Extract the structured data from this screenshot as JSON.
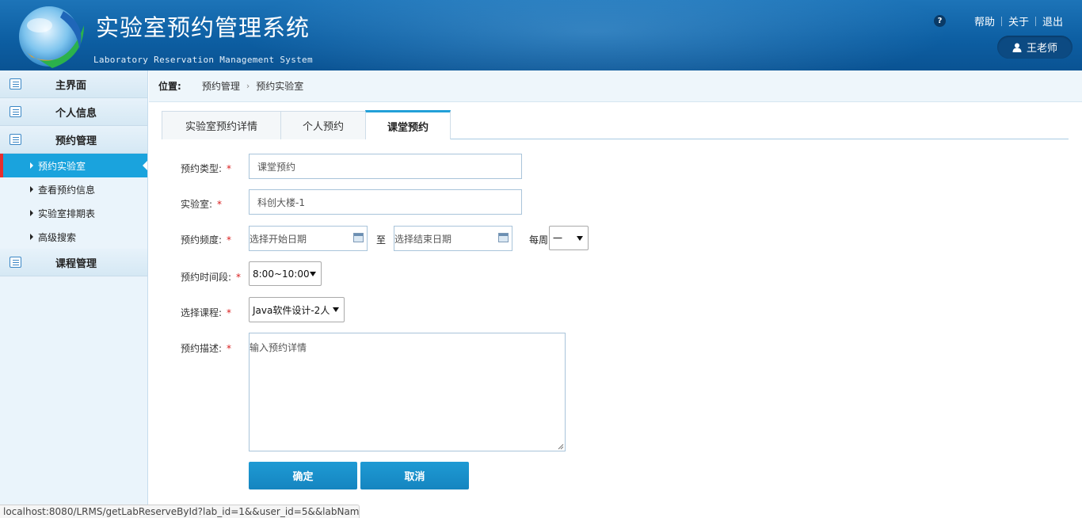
{
  "header": {
    "title": "实验室预约管理系统",
    "subtitle": "Laboratory Reservation Management System",
    "help_icon": "?",
    "links": [
      "帮助",
      "关于",
      "退出"
    ],
    "user": "王老师"
  },
  "sidebar": {
    "sections": [
      {
        "label": "主界面"
      },
      {
        "label": "个人信息"
      },
      {
        "label": "预约管理",
        "items": [
          "预约实验室",
          "查看预约信息",
          "实验室排期表",
          "高级搜索"
        ],
        "active_item": "预约实验室"
      },
      {
        "label": "课程管理"
      }
    ]
  },
  "breadcrumb": {
    "label": "位置:",
    "items": [
      "预约管理",
      "预约实验室"
    ]
  },
  "tabs": [
    {
      "label": "实验室预约详情"
    },
    {
      "label": "个人预约"
    },
    {
      "label": "课堂预约",
      "active": true
    }
  ],
  "form": {
    "type_label": "预约类型:",
    "type_value": "课堂预约",
    "lab_label": "实验室:",
    "lab_value": "科创大楼-1",
    "freq_label": "预约频度:",
    "start_placeholder": "选择开始日期",
    "to_label": "至",
    "end_placeholder": "选择结束日期",
    "week_label": "每周",
    "week_value": "一",
    "time_label": "预约时间段:",
    "time_value": "8:00~10:00",
    "course_label": "选择课程:",
    "course_value": "Java软件设计-2人",
    "desc_label": "预约描述:",
    "desc_placeholder": "输入预约详情",
    "required_mark": "*"
  },
  "buttons": {
    "confirm": "确定",
    "cancel": "取消"
  },
  "status_bar": "localhost:8080/LRMS/getLabReserveById?lab_id=1&&user_id=5&&labNam...",
  "colors": {
    "header_blue": "#0d5fa3",
    "active_blue": "#1aa3dd",
    "button_blue": "#1585c0",
    "required_red": "#d91c1c"
  }
}
